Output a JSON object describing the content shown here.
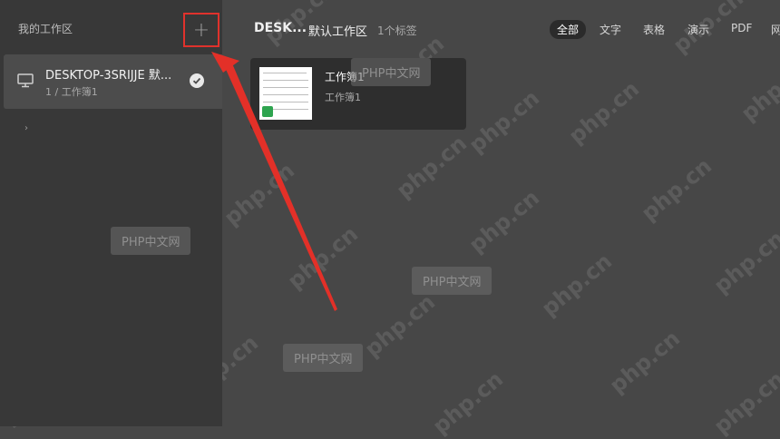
{
  "sidebar": {
    "title": "我的工作区",
    "add_label": "+",
    "device": {
      "name": "DESKTOP-3SRIJJE 默...",
      "subtitle": "1 / 工作簿1"
    }
  },
  "header": {
    "device_name": "DESK...",
    "workspace_name": "默认工作区",
    "tag_count": "1个标签"
  },
  "filters": [
    "全部",
    "文字",
    "表格",
    "演示",
    "PDF",
    "网"
  ],
  "active_filter_index": 0,
  "cards": [
    {
      "title": "工作簿1",
      "subtitle": "工作簿1",
      "icon": "spreadsheet-icon"
    }
  ],
  "watermarks": {
    "label": "PHP中文网",
    "site": "php.cn"
  },
  "colors": {
    "sidebar_bg": "#383838",
    "main_bg": "#474747",
    "card_bg": "#2e2e2e",
    "highlight": "#e0322c",
    "sheet_icon": "#2ea44f"
  }
}
